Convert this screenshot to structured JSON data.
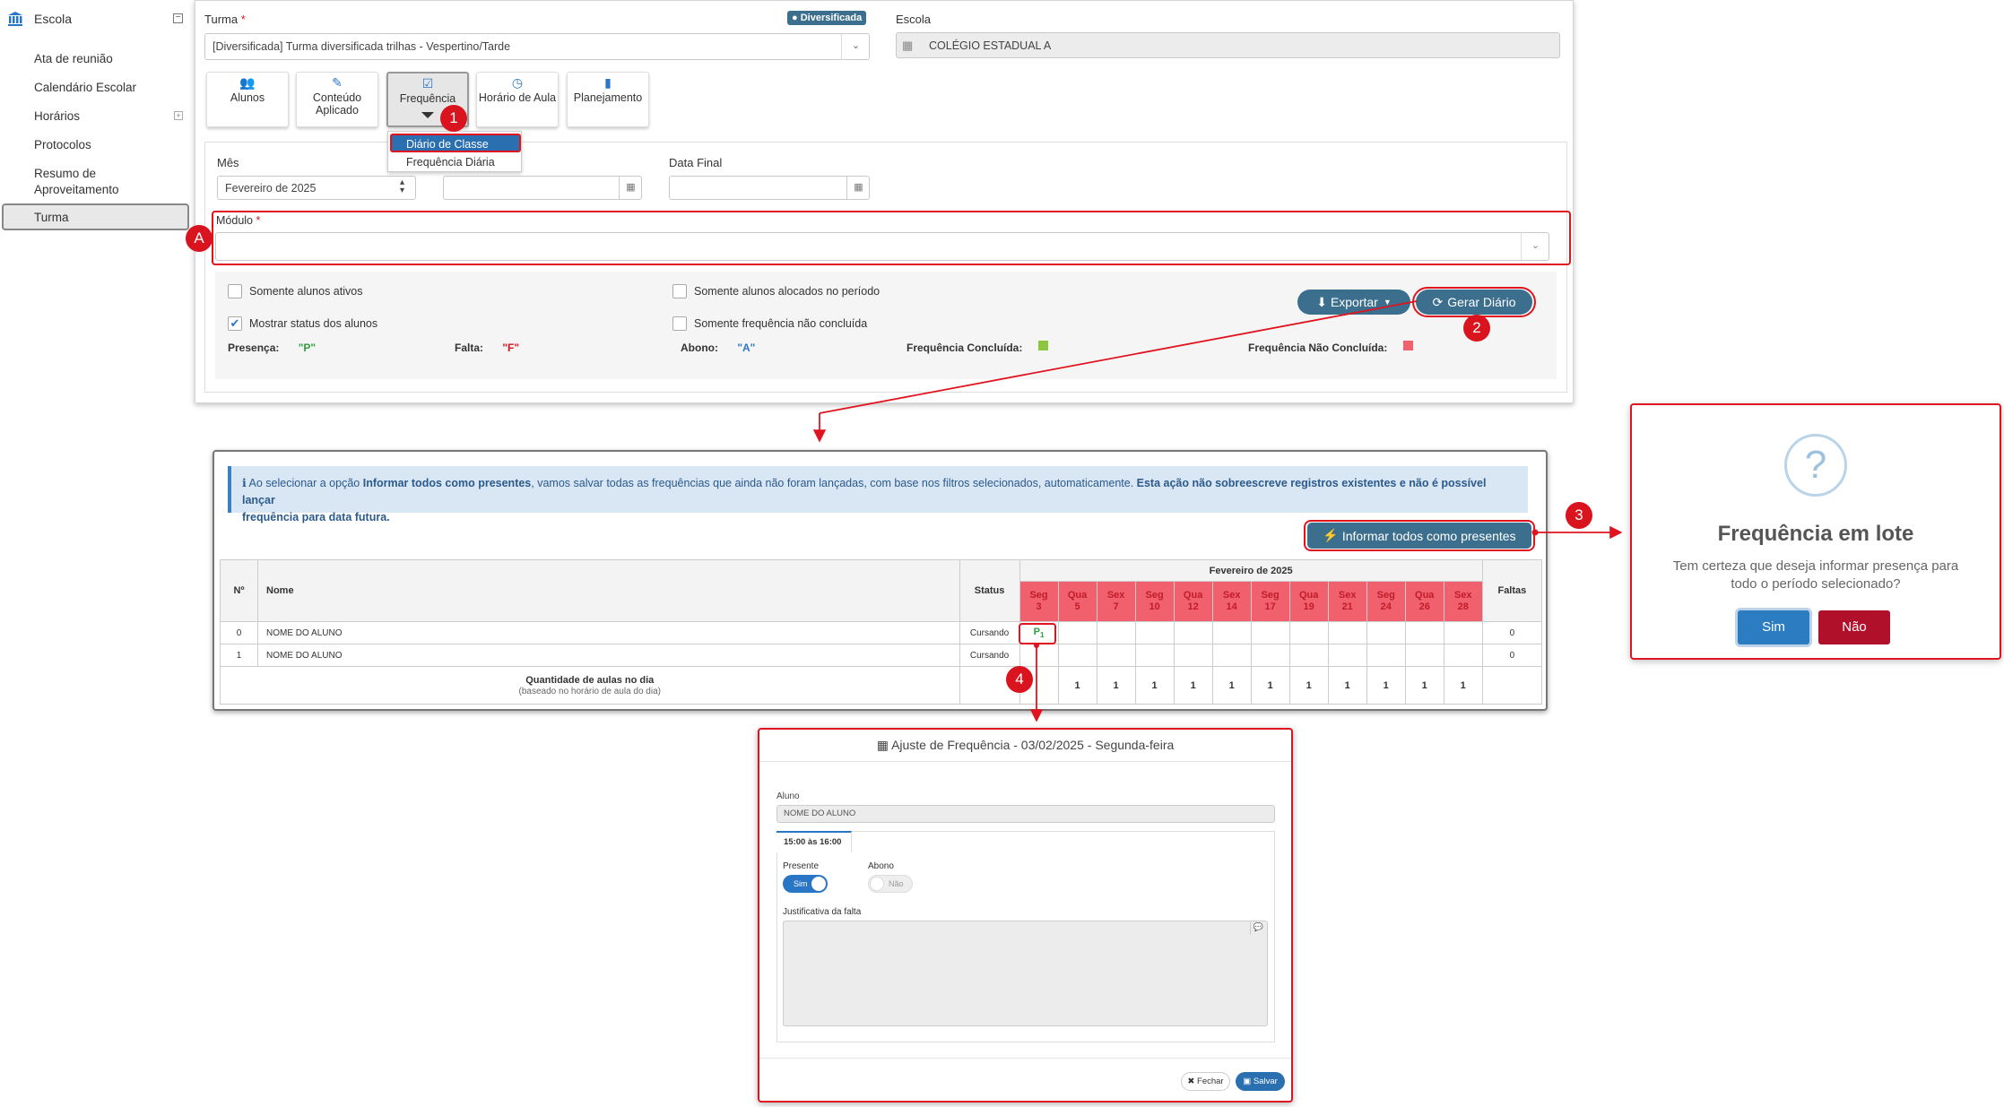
{
  "sidebar": {
    "school_label": "Escola",
    "items": [
      {
        "label": "Ata de reunião"
      },
      {
        "label": "Calendário Escolar"
      },
      {
        "label": "Horários"
      },
      {
        "label": "Protocolos"
      },
      {
        "label": "Resumo de Aproveitamento"
      },
      {
        "label": "Turma"
      }
    ]
  },
  "form": {
    "turma_label": "Turma",
    "required_mark": "*",
    "turma_badge": "Diversificada",
    "turma_value": "[Diversificada]  Turma diversificada trilhas - Vespertino/Tarde",
    "escola_label": "Escola",
    "escola_value": "COLÉGIO ESTADUAL A",
    "tabs": [
      {
        "label": "Alunos",
        "icon": "users-icon"
      },
      {
        "label": "Conteúdo Aplicado",
        "icon": "wand-icon"
      },
      {
        "label": "Frequência",
        "icon": "check-square-icon"
      },
      {
        "label": "Horário de Aula",
        "icon": "clock-icon"
      },
      {
        "label": "Planejamento",
        "icon": "book-icon"
      }
    ],
    "dropdown": {
      "item1": "Diário de Classe",
      "item2": "Frequência Diária"
    },
    "mes_label": "Mês",
    "mes_value": "Fevereiro de 2025",
    "data_final_label": "Data Final",
    "modulo_label": "Módulo",
    "checkboxes": {
      "ativos": "Somente alunos ativos",
      "status": "Mostrar status dos alunos",
      "alocados": "Somente alunos alocados no período",
      "nao_concluida": "Somente frequência não concluída"
    },
    "exportar": "Exportar",
    "gerar": "Gerar Diário",
    "legend": {
      "presenca": "Presença:",
      "presenca_v": "\"P\"",
      "falta": "Falta:",
      "falta_v": "\"F\"",
      "abono": "Abono:",
      "abono_v": "\"A\"",
      "concluida": "Frequência Concluída:",
      "nao_concluida": "Frequência Não Concluída:"
    }
  },
  "diary": {
    "info_pre": "Ao selecionar a opção ",
    "info_bold1": "Informar todos como presentes",
    "info_mid": ", vamos salvar todas as frequências que ainda não foram lançadas, com base nos filtros selecionados, automaticamente. ",
    "info_bold2a": "Esta ação não sobreescreve registros existentes e não é possível lançar",
    "info_bold2b": "frequência para data futura.",
    "btn_informar": "Informar todos como presentes",
    "col_n": "Nº",
    "col_nome": "Nome",
    "col_status": "Status",
    "month": "Fevereiro de 2025",
    "col_faltas": "Faltas",
    "days": [
      {
        "d": "Seg",
        "n": "3"
      },
      {
        "d": "Qua",
        "n": "5"
      },
      {
        "d": "Sex",
        "n": "7"
      },
      {
        "d": "Seg",
        "n": "10"
      },
      {
        "d": "Qua",
        "n": "12"
      },
      {
        "d": "Sex",
        "n": "14"
      },
      {
        "d": "Seg",
        "n": "17"
      },
      {
        "d": "Qua",
        "n": "19"
      },
      {
        "d": "Sex",
        "n": "21"
      },
      {
        "d": "Seg",
        "n": "24"
      },
      {
        "d": "Qua",
        "n": "26"
      },
      {
        "d": "Sex",
        "n": "28"
      }
    ],
    "rows": [
      {
        "n": "0",
        "nome": "NOME DO ALUNO",
        "status": "Cursando",
        "first": "P",
        "sub": "1",
        "faltas": "0"
      },
      {
        "n": "1",
        "nome": "NOME DO ALUNO",
        "status": "Cursando",
        "first": "",
        "sub": "",
        "faltas": "0"
      }
    ],
    "qtd_label": "Quantidade de aulas no dia",
    "qtd_sub": "(baseado no horário de aula do dia)",
    "qtd_values": [
      "",
      "1",
      "1",
      "1",
      "1",
      "1",
      "1",
      "1",
      "1",
      "1",
      "1",
      "1"
    ]
  },
  "modal": {
    "icon": "question-icon",
    "title": "Frequência em lote",
    "text1": "Tem certeza que deseja informar presença para",
    "text2": "todo o período selecionado?",
    "sim": "Sim",
    "nao": "Não"
  },
  "ajuste": {
    "title": "Ajuste de Frequência - 03/02/2025 - Segunda-feira",
    "aluno_label": "Aluno",
    "aluno_value": "NOME DO ALUNO",
    "tab": "15:00 às 16:00",
    "presente_label": "Presente",
    "presente_toggle": "Sim",
    "abono_label": "Abono",
    "abono_toggle": "Não",
    "justificativa_label": "Justificativa da falta",
    "fechar": "Fechar",
    "salvar": "Salvar"
  },
  "badges": {
    "b1": "1",
    "b2": "2",
    "b3": "3",
    "b4": "4",
    "bA": "A"
  },
  "colors": {
    "accent": "#2a76c6",
    "red": "#e0141e",
    "dark_btn": "#3c6f8d",
    "present_green": "#2e9e3e",
    "done_green": "#8cc63f",
    "undone_red": "#f0606d",
    "nao_btn": "#b0102a"
  }
}
